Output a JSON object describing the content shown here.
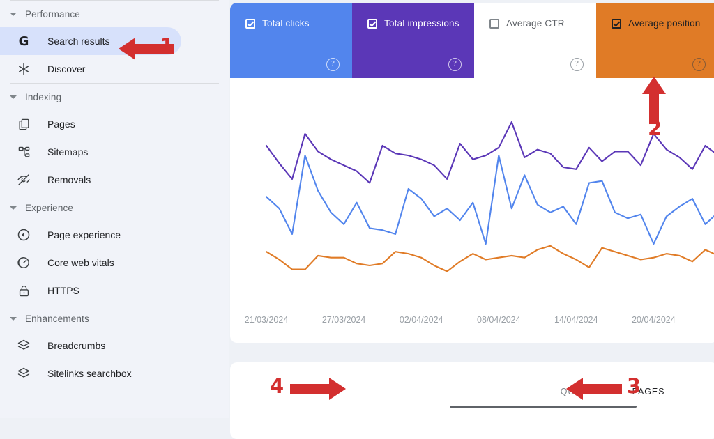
{
  "sidebar": {
    "sections": [
      {
        "label": "Performance",
        "items": [
          {
            "label": "Search results",
            "icon": "google-g-icon",
            "active": true
          },
          {
            "label": "Discover",
            "icon": "asterisk-icon",
            "active": false
          }
        ]
      },
      {
        "label": "Indexing",
        "items": [
          {
            "label": "Pages",
            "icon": "pages-copy-icon",
            "active": false
          },
          {
            "label": "Sitemaps",
            "icon": "sitemap-tree-icon",
            "active": false
          },
          {
            "label": "Removals",
            "icon": "eye-off-icon",
            "active": false
          }
        ]
      },
      {
        "label": "Experience",
        "items": [
          {
            "label": "Page experience",
            "icon": "page-experience-icon",
            "active": false
          },
          {
            "label": "Core web vitals",
            "icon": "speedometer-icon",
            "active": false
          },
          {
            "label": "HTTPS",
            "icon": "lock-icon",
            "active": false
          }
        ]
      },
      {
        "label": "Enhancements",
        "items": [
          {
            "label": "Breadcrumbs",
            "icon": "layers-icon",
            "active": false
          },
          {
            "label": "Sitelinks searchbox",
            "icon": "layers-icon",
            "active": false
          }
        ]
      }
    ]
  },
  "metrics": [
    {
      "label": "Total clicks",
      "checked": true,
      "color": "#5285ed",
      "style": "solid"
    },
    {
      "label": "Total impressions",
      "checked": true,
      "color": "#5b37b7",
      "style": "solid"
    },
    {
      "label": "Average CTR",
      "checked": false,
      "color": "#ffffff",
      "style": "light"
    },
    {
      "label": "Average position",
      "checked": true,
      "color": "#e07b26",
      "style": "dark"
    }
  ],
  "help_icon": "?",
  "bottom_tabs": [
    {
      "label": "QUERIES",
      "active": false
    },
    {
      "label": "PAGES",
      "active": true
    }
  ],
  "annotations": [
    {
      "number": "1",
      "direction": "left",
      "target": "sidebar-item-search-results"
    },
    {
      "number": "2",
      "direction": "up",
      "target": "metric-average-position"
    },
    {
      "number": "3",
      "direction": "left",
      "target": "tab-pages"
    },
    {
      "number": "4",
      "direction": "right",
      "target": "tab-queries"
    }
  ],
  "colors": {
    "accent_red": "#d32f2f",
    "page_background": "#eef1f6",
    "sidebar_background": "#f1f3f9",
    "active_item_background": "#d7e1fb"
  },
  "chart_data": {
    "type": "line",
    "title": "",
    "xlabel": "",
    "ylabel": "",
    "grid": false,
    "legend": "top-cards",
    "x_tick_labels": [
      "21/03/2024",
      "27/03/2024",
      "02/04/2024",
      "08/04/2024",
      "14/04/2024",
      "20/04/2024"
    ],
    "x_tick_positions": [
      0,
      6,
      12,
      18,
      24,
      30
    ],
    "n_points": 36,
    "series": [
      {
        "name": "Total impressions",
        "color": "#5b37b7",
        "values": [
          72,
          63,
          55,
          78,
          69,
          65,
          62,
          59,
          53,
          72,
          68,
          67,
          65,
          62,
          55,
          73,
          65,
          67,
          71,
          84,
          66,
          70,
          68,
          61,
          60,
          71,
          64,
          69,
          69,
          62,
          78,
          70,
          66,
          60,
          72,
          67
        ]
      },
      {
        "name": "Total clicks",
        "color": "#5285ed",
        "values": [
          46,
          40,
          27,
          67,
          49,
          38,
          32,
          43,
          30,
          29,
          27,
          50,
          45,
          36,
          40,
          34,
          43,
          22,
          67,
          40,
          57,
          42,
          38,
          41,
          32,
          53,
          54,
          38,
          35,
          37,
          22,
          36,
          41,
          45,
          32,
          38
        ]
      },
      {
        "name": "Average position",
        "color": "#e07b26",
        "values": [
          18,
          14,
          9,
          9,
          16,
          15,
          15,
          12,
          11,
          12,
          18,
          17,
          15,
          11,
          8,
          13,
          17,
          14,
          15,
          16,
          15,
          19,
          21,
          17,
          14,
          10,
          20,
          18,
          16,
          14,
          15,
          17,
          16,
          13,
          19,
          16
        ]
      }
    ],
    "ylim_pixels": {
      "top": 0,
      "bottom": 100
    }
  }
}
